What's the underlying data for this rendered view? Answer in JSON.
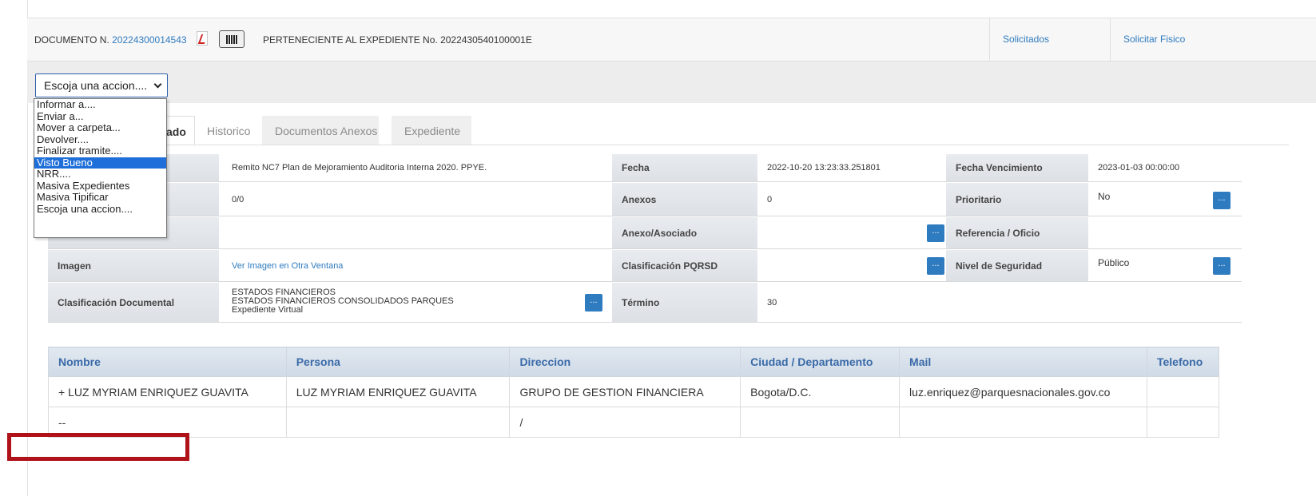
{
  "document_bar": {
    "doc_prefix": "DOCUMENTO N.",
    "doc_number": "20224300014543",
    "expediente_text": "PERTENECIENTE AL EXPEDIENTE No. 2022430540100001E",
    "link_solicitados": "Solicitados",
    "link_solicitar_fisico": "Solicitar Fisico"
  },
  "action_select": {
    "selected": "Escoja una accion....",
    "options": [
      "Informar a....",
      "Enviar a...",
      "Mover a carpeta...",
      "Devolver....",
      "Finalizar tramite....",
      "Visto Bueno",
      "NRR....",
      "Masiva Expedientes",
      "Masiva Tipificar",
      "Escoja una accion...."
    ],
    "highlighted": "Visto Bueno"
  },
  "tabs": [
    {
      "label": "ado"
    },
    {
      "label": "Historico"
    },
    {
      "label": "Documentos Anexos"
    },
    {
      "label": "Expediente"
    }
  ],
  "info": {
    "asunto_value": "Remito NC7 Plan de Mejoramiento Auditoria Interna 2020. PPYE.",
    "fecha_label": "Fecha",
    "fecha_value": "2022-10-20 13:23:33.251801",
    "venc_label": "Fecha Vencimiento",
    "venc_value": "2023-01-03 00:00:00",
    "folios_value": "0/0",
    "anexos_label": "Anexos",
    "anexos_value": "0",
    "prioritario_label": "Prioritario",
    "prioritario_value": "No",
    "anexo_asoc_label": "Anexo/Asociado",
    "referencia_label": "Referencia / Oficio",
    "imagen_label": "Imagen",
    "imagen_link": "Ver Imagen en Otra Ventana",
    "pqrsd_label": "Clasificación PQRSD",
    "seguridad_label": "Nivel de Seguridad",
    "seguridad_value": "Público",
    "clasif_doc_label": "Clasificación Documental",
    "clasif_doc_line1": "ESTADOS FINANCIEROS",
    "clasif_doc_line2": "ESTADOS FINANCIEROS CONSOLIDADOS PARQUES",
    "clasif_doc_line3": "Expediente Virtual",
    "termino_label": "Término",
    "termino_value": "30",
    "ellipsis": "..."
  },
  "persons": {
    "headers": [
      "Nombre",
      "Persona",
      "Direccion",
      "Ciudad / Departamento",
      "Mail",
      "Telefono"
    ],
    "rows": [
      [
        "+ LUZ MYRIAM ENRIQUEZ GUAVITA",
        "LUZ MYRIAM ENRIQUEZ GUAVITA",
        "GRUPO DE GESTION FINANCIERA",
        "Bogota/D.C.",
        "luz.enriquez@parquesnacionales.gov.co",
        ""
      ],
      [
        "--",
        "",
        "/",
        "",
        "",
        ""
      ]
    ]
  },
  "colors": {
    "link": "#2f7bbf",
    "highlight": "#1e6fd9",
    "annotation_box": "#b0121a"
  }
}
